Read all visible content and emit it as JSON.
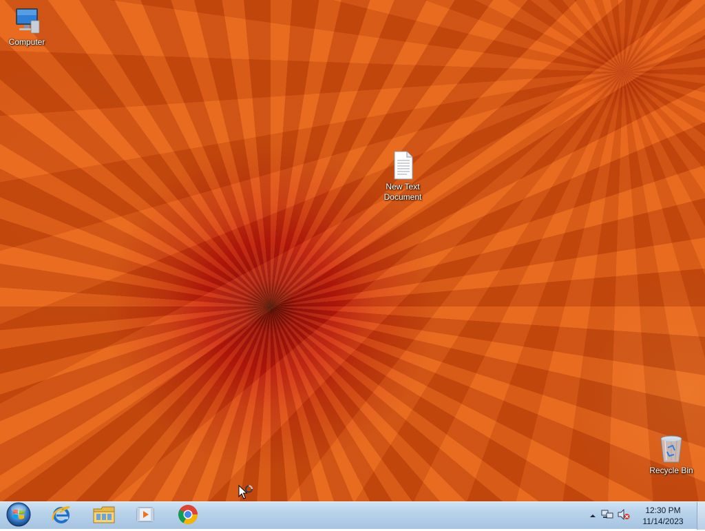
{
  "desktop": {
    "icons": [
      {
        "label": "Computer",
        "icon": "computer-icon"
      },
      {
        "label": "New Text\nDocument",
        "icon": "text-document-icon"
      },
      {
        "label": "Recycle Bin",
        "icon": "recycle-bin-icon"
      }
    ]
  },
  "taskbar": {
    "start": {
      "icon": "windows-orb-icon"
    },
    "pinned": [
      {
        "icon": "internet-explorer-icon"
      },
      {
        "icon": "file-explorer-icon"
      },
      {
        "icon": "media-player-icon"
      },
      {
        "icon": "chrome-icon"
      }
    ],
    "tray": {
      "arrow_icon": "show-hidden-icons-arrow",
      "network_icon": "network-icon",
      "volume_icon": "volume-muted-icon",
      "time": "12:30 PM",
      "date": "11/14/2023"
    }
  },
  "colors": {
    "wallpaper_orange": "#de5a12",
    "wallpaper_center": "#5a0505",
    "taskbar": "#b8d2ea",
    "label_text": "#ffffff"
  }
}
